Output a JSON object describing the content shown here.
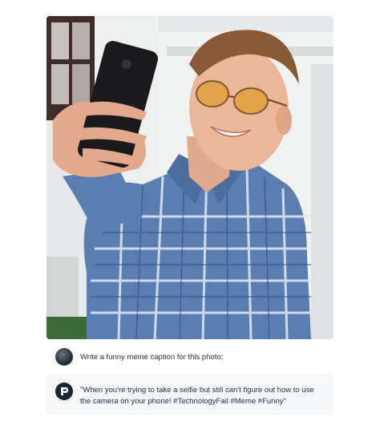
{
  "photo": {
    "subject": "selfie-photo"
  },
  "conversation": {
    "prompt": "Write a funny meme caption for this photo;",
    "reply_line1": "\"When you're trying to take a selfie but still can't figure out how to use",
    "reply_line2": "the camera on your phone! #TechnologyFail #Meme #Funny\""
  },
  "colors": {
    "reply_bg": "#f6f7f9",
    "avatar_dark": "#1c2533",
    "text": "#2a3242"
  }
}
